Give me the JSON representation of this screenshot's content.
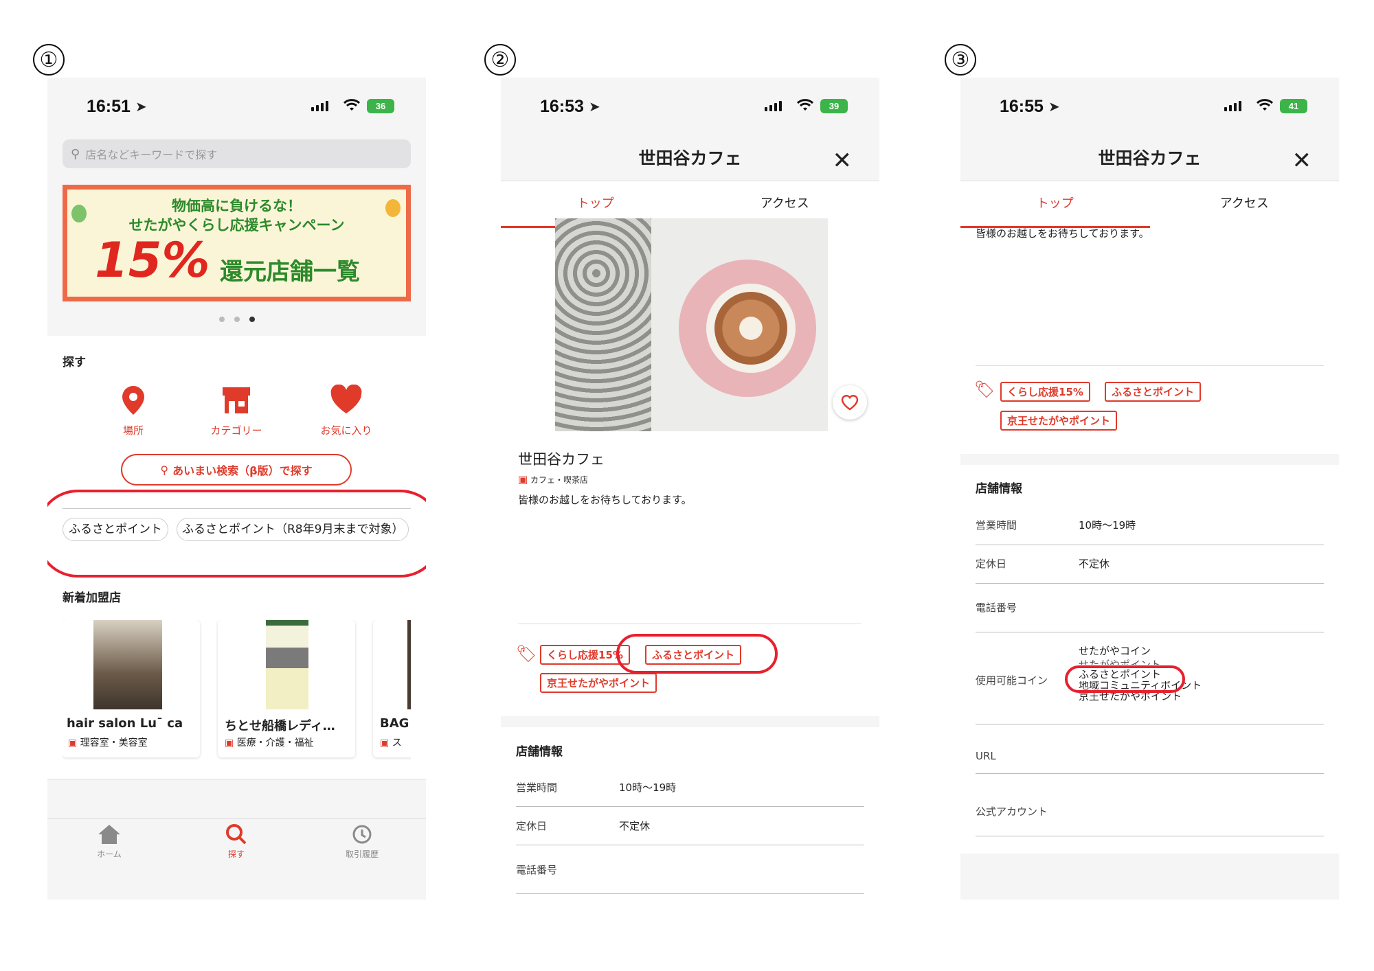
{
  "labels": {
    "one": "①",
    "two": "②",
    "three": "③"
  },
  "p1": {
    "time": "16:51",
    "battery": "36",
    "search_placeholder": "店名などキーワードで探す",
    "banner": {
      "line1": "物価高に負けるな！",
      "line2": "せたがやくらし応援キャンペーン",
      "big": "15%",
      "right": "還元店舗一覧"
    },
    "section_search": "探す",
    "cats": [
      "場所",
      "カテゴリー",
      "お気に入り"
    ],
    "fuzzy_btn": "あいまい検索（β版）で探す",
    "chips": [
      "ふるさとポイント",
      "ふるさとポイント（R8年9月末まで対象）"
    ],
    "new_title": "新着加盟店",
    "cards": [
      {
        "name": "hair salon Lu¯ ca",
        "cat": "理容室・美容室"
      },
      {
        "name": "ちとせ船橋レディ…",
        "cat": "医療・介護・福祉"
      },
      {
        "name": "BAG (",
        "cat": "ス"
      }
    ],
    "nav": [
      "ホーム",
      "探す",
      "取引履歴"
    ]
  },
  "p2": {
    "time": "16:53",
    "battery": "39",
    "title": "世田谷カフェ",
    "tabs": [
      "トップ",
      "アクセス"
    ],
    "shop_name": "世田谷カフェ",
    "shop_cat": "カフェ・喫茶店",
    "desc": "皆様のお越しをお待ちしております。",
    "tags": [
      "くらし応援15%",
      "ふるさとポイント",
      "京王せたがやポイント"
    ],
    "info_title": "店舗情報",
    "rows": [
      {
        "label": "営業時間",
        "value": "10時〜19時"
      },
      {
        "label": "定休日",
        "value": "不定休"
      },
      {
        "label": "電話番号",
        "value": ""
      }
    ]
  },
  "p3": {
    "time": "16:55",
    "battery": "41",
    "title": "世田谷カフェ",
    "tabs": [
      "トップ",
      "アクセス"
    ],
    "desc": "皆様のお越しをお待ちしております。",
    "tags": [
      "くらし応援15%",
      "ふるさとポイント",
      "京王せたがやポイント"
    ],
    "info_title": "店舗情報",
    "rows": [
      {
        "label": "営業時間",
        "value": "10時〜19時"
      },
      {
        "label": "定休日",
        "value": "不定休"
      },
      {
        "label": "電話番号",
        "value": ""
      }
    ],
    "coins_label": "使用可能コイン",
    "coins": [
      "せたがやコイン",
      "せたがやポイント",
      "ふるさとポイント",
      "地域コミュニティポイント",
      "京王せたがやポイント"
    ],
    "url_label": "URL",
    "official_label": "公式アカウント"
  },
  "colors": {
    "accent": "#e03a2b",
    "highlight": "#e8202e"
  }
}
